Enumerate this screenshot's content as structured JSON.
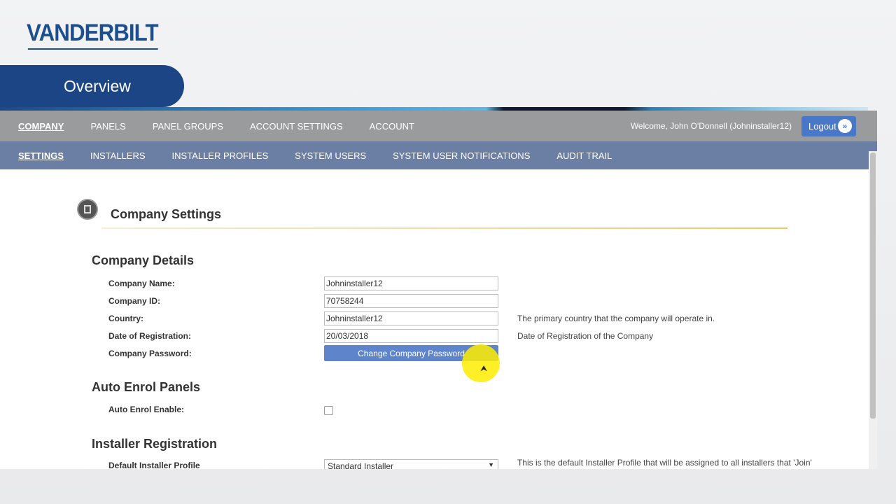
{
  "brand": {
    "logo_text": "VANDERBILT"
  },
  "page_tab": {
    "label": "Overview"
  },
  "nav_primary": {
    "items": [
      "COMPANY",
      "PANELS",
      "PANEL GROUPS",
      "ACCOUNT SETTINGS",
      "ACCOUNT"
    ],
    "active": "COMPANY",
    "welcome_text": "Welcome, John O'Donnell (Johninstaller12)",
    "logout_label": "Logout",
    "logout_icon": "double-chevron-right-icon"
  },
  "nav_secondary": {
    "items": [
      "SETTINGS",
      "INSTALLERS",
      "INSTALLER PROFILES",
      "SYSTEM USERS",
      "SYSTEM USER NOTIFICATIONS",
      "AUDIT TRAIL"
    ],
    "active": "SETTINGS"
  },
  "content": {
    "title": "Company Settings",
    "title_icon": "building-icon",
    "company_details": {
      "heading": "Company Details",
      "company_name_label": "Company Name:",
      "company_name_value": "Johninstaller12",
      "company_id_label": "Company ID:",
      "company_id_value": "70758244",
      "country_label": "Country:",
      "country_value": "Johninstaller12",
      "country_hint": "The primary country that the company will operate in.",
      "registration_label": "Date of Registration:",
      "registration_value": "20/03/2018",
      "registration_hint": "Date of Registration of the Company",
      "password_label": "Company Password:",
      "password_button": "Change Company Password"
    },
    "auto_enrol": {
      "heading": "Auto Enrol Panels",
      "enable_label": "Auto Enrol Enable:",
      "enable_checked": false
    },
    "installer_registration": {
      "heading": "Installer Registration",
      "profile_label": "Default Installer Profile",
      "profile_value": "Standard Installer",
      "profile_hint": "This is the default Installer Profile that will be assigned to all installers that 'Join'"
    }
  },
  "colors": {
    "brand_blue": "#1c4585",
    "nav_primary_bg": "#9a9b9d",
    "nav_secondary_bg": "#6a7fa3",
    "button_blue": "#5e85cc",
    "cursor_highlight": "#ffec00"
  }
}
